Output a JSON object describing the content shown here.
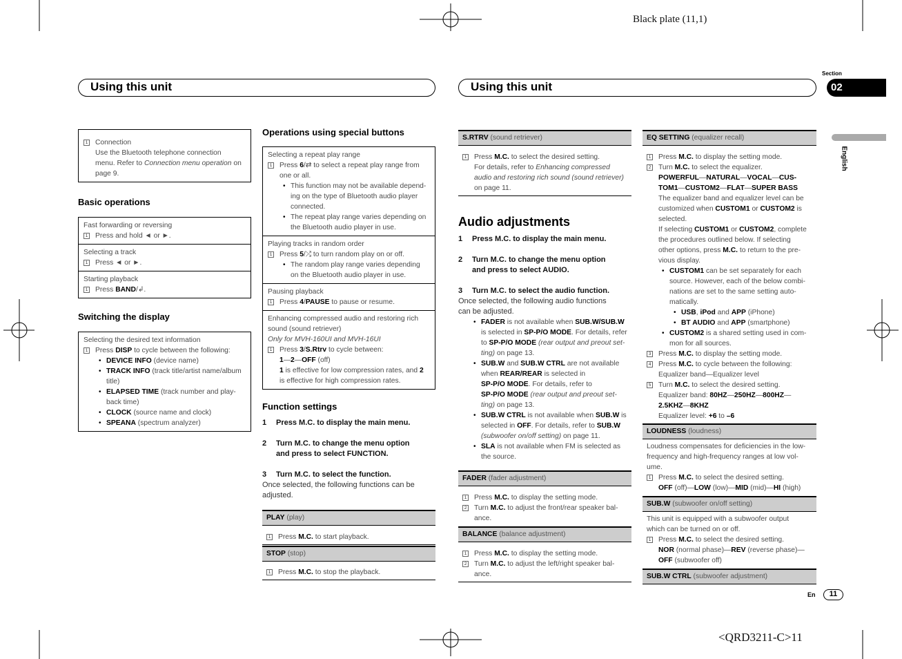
{
  "plate": "Black plate (11,1)",
  "doc_code": "<QRD3211-C>11",
  "left_title": "Using this unit",
  "right_title": "Using this unit",
  "section_label": "Section",
  "section_number": "02",
  "language": "English",
  "footer_lang": "En",
  "page_number": "11",
  "icons": {
    "repeat": "repeat-icon",
    "random": "shuffle-icon",
    "band": "return-icon",
    "prev": "left-triangle",
    "next": "right-triangle"
  },
  "columns": [
    {
      "blocks": [
        {
          "type": "box",
          "rows": [
            [
              [
                "n",
                "Connection",
                "1"
              ],
              [
                "c",
                "Use the Bluetooth telephone connection"
              ],
              [
                "c",
                "menu. Refer to __Connection menu operation__ on"
              ],
              [
                "c",
                "page 9."
              ]
            ]
          ]
        },
        {
          "type": "heading",
          "text": "Basic operations"
        },
        {
          "type": "box",
          "rows": [
            [
              [
                "p",
                "Fast forwarding or reversing"
              ],
              [
                "n",
                "Press and hold ◄ or ►.",
                "1"
              ]
            ],
            [
              [
                "p",
                "Selecting a track"
              ],
              [
                "n",
                "Press ◄ or ►.",
                "1"
              ]
            ],
            [
              [
                "p",
                "Starting playback"
              ],
              [
                "n",
                "Press **BAND**/↲.",
                "1"
              ]
            ]
          ]
        },
        {
          "type": "heading",
          "text": "Switching the display"
        },
        {
          "type": "box",
          "rows": [
            [
              [
                "p",
                "Selecting the desired text information"
              ],
              [
                "n",
                "Press **DISP** to cycle between the following:",
                "1"
              ],
              [
                "b",
                "**DEVICE INFO** (device name)"
              ],
              [
                "b",
                "**TRACK INFO** (track title/artist name/album"
              ],
              [
                "bc",
                "title)"
              ],
              [
                "b",
                "**ELAPSED TIME** (track number and play-"
              ],
              [
                "bc",
                "back time)"
              ],
              [
                "b",
                "**CLOCK** (source name and clock)"
              ],
              [
                "b",
                "**SPEANA** (spectrum analyzer)"
              ]
            ]
          ]
        }
      ]
    },
    {
      "blocks": [
        {
          "type": "heading",
          "text": "Operations using special buttons"
        },
        {
          "type": "box",
          "rows": [
            [
              [
                "p",
                "Selecting a repeat play range"
              ],
              [
                "n",
                "Press **6**/⇄ to select a repeat play range from",
                "1"
              ],
              [
                "c",
                "one or all."
              ],
              [
                "b",
                "This function may not be available depend-"
              ],
              [
                "bc",
                "ing on the type of Bluetooth audio player"
              ],
              [
                "bc",
                "connected."
              ],
              [
                "b",
                "The repeat play range varies depending on"
              ],
              [
                "bc",
                "the Bluetooth audio player in use."
              ]
            ],
            [
              [
                "p",
                "Playing tracks in random order"
              ],
              [
                "n",
                "Press **5**/⤮ to turn random play on or off.",
                "1"
              ],
              [
                "b",
                "The random play range varies depending"
              ],
              [
                "bc",
                "on the Bluetooth audio player in use."
              ]
            ],
            [
              [
                "p",
                "Pausing playback"
              ],
              [
                "n",
                "Press **4**/**PAUSE** to pause or resume.",
                "1"
              ]
            ],
            [
              [
                "p",
                "Enhancing compressed audio and restoring rich"
              ],
              [
                "p",
                "sound (sound retriever)"
              ],
              [
                "p",
                "__Only for MVH-160UI and MVH-16UI__"
              ],
              [
                "n",
                "Press **3**/**S.Rtrv** to cycle between:",
                "1"
              ],
              [
                "c",
                "**1**—**2**—**OFF** (off)"
              ],
              [
                "c",
                "**1** is effective for low compression rates, and **2**"
              ],
              [
                "c",
                "is effective for high compression rates."
              ]
            ]
          ]
        },
        {
          "type": "heading",
          "text": "Function settings"
        },
        {
          "type": "lines",
          "lines": [
            [
              "s",
              "Press M.C. to display the main menu.",
              "1"
            ],
            [
              "gap",
              ""
            ],
            [
              "s",
              "Turn M.C. to change the menu option",
              "2"
            ],
            [
              "s0",
              "and press to select FUNCTION."
            ],
            [
              "gap",
              ""
            ],
            [
              "s",
              "Turn M.C. to select the function.",
              "3"
            ],
            [
              "q",
              "Once selected, the following functions can be"
            ],
            [
              "q",
              "adjusted."
            ]
          ]
        },
        {
          "type": "bar",
          "label": "PLAY",
          "sub": "(play)"
        },
        {
          "type": "lines",
          "lines": [
            [
              "n",
              "Press **M.C.** to start playback.",
              "1"
            ]
          ]
        },
        {
          "type": "bar",
          "label": "STOP",
          "sub": "(stop)"
        },
        {
          "type": "lines",
          "lines": [
            [
              "n",
              "Press **M.C.** to stop the playback.",
              "1"
            ]
          ]
        }
      ]
    },
    {
      "blocks": [
        {
          "type": "bar",
          "label": "S.RTRV",
          "sub": "(sound retriever)"
        },
        {
          "type": "lines",
          "lines": [
            [
              "n",
              "Press **M.C.** to select the desired setting.",
              "1"
            ],
            [
              "c",
              "For details, refer to __Enhancing compressed__"
            ],
            [
              "c",
              "__audio and restoring rich sound (sound retriever)__"
            ],
            [
              "c",
              "on page 11."
            ]
          ]
        },
        {
          "type": "heading",
          "text": "Audio adjustments"
        },
        {
          "type": "lines",
          "lines": [
            [
              "s",
              "Press M.C. to display the main menu.",
              "1"
            ],
            [
              "gap",
              ""
            ],
            [
              "s",
              "Turn M.C. to change the menu option",
              "2"
            ],
            [
              "s0",
              "and press to select AUDIO."
            ],
            [
              "gap",
              ""
            ],
            [
              "s",
              "Turn M.C. to select the audio function.",
              "3"
            ],
            [
              "q",
              "Once selected, the following audio functions"
            ],
            [
              "q",
              "can be adjusted."
            ],
            [
              "b",
              "**FADER** is not available when **SUB.W/SUB.W**"
            ],
            [
              "bc",
              "is selected in **SP-P/O MODE**. For details, refer"
            ],
            [
              "bc",
              "to **SP-P/O MODE** __(rear output and preout set-__"
            ],
            [
              "bc",
              "__ting)__ on page 13."
            ],
            [
              "b",
              "**SUB.W** and **SUB.W CTRL** are not available"
            ],
            [
              "bc",
              "when **REAR/REAR** is selected in"
            ],
            [
              "bc",
              "**SP-P/O MODE**. For details, refer to"
            ],
            [
              "bc",
              "**SP-P/O MODE** __(rear output and preout set-__"
            ],
            [
              "bc",
              "__ting)__ on page 13."
            ],
            [
              "b",
              "**SUB.W CTRL** is not available when **SUB.W** is"
            ],
            [
              "bc",
              "selected in **OFF**. For details, refer to **SUB.W**"
            ],
            [
              "bc",
              "__(subwoofer on/off setting)__ on page 11."
            ],
            [
              "b",
              "**SLA** is not available when FM is selected as"
            ],
            [
              "bc",
              "the source."
            ]
          ]
        },
        {
          "type": "bar",
          "label": "FADER",
          "sub": "(fader adjustment)"
        },
        {
          "type": "lines",
          "lines": [
            [
              "n",
              "Press **M.C.** to display the setting mode.",
              "1"
            ],
            [
              "n",
              "Turn **M.C.** to adjust the front/rear speaker bal-",
              "2"
            ],
            [
              "c",
              "ance."
            ]
          ]
        },
        {
          "type": "bar",
          "label": "BALANCE",
          "sub": "(balance adjustment)"
        },
        {
          "type": "lines",
          "lines": [
            [
              "n",
              "Press **M.C.** to display the setting mode.",
              "1"
            ],
            [
              "n",
              "Turn **M.C.** to adjust the left/right speaker bal-",
              "2"
            ],
            [
              "c",
              "ance."
            ]
          ]
        }
      ]
    },
    {
      "blocks": [
        {
          "type": "bar",
          "label": "EQ SETTING",
          "sub": "(equalizer recall)"
        },
        {
          "type": "lines",
          "lines": [
            [
              "n",
              "Press **M.C.** to display the setting mode.",
              "1"
            ],
            [
              "n",
              "Turn **M.C.** to select the equalizer.",
              "2"
            ],
            [
              "c",
              "**POWERFUL**—**NATURAL**—**VOCAL**—**CUS-**"
            ],
            [
              "c",
              "**TOM1**—**CUSTOM2**—**FLAT**—**SUPER BASS**"
            ],
            [
              "c",
              "The equalizer band and equalizer level can be"
            ],
            [
              "c",
              "customized when **CUSTOM1** or **CUSTOM2** is"
            ],
            [
              "c",
              "selected."
            ],
            [
              "c",
              "If selecting **CUSTOM1** or **CUSTOM2**, complete"
            ],
            [
              "c",
              "the procedures outlined below. If selecting"
            ],
            [
              "c",
              "other options, press **M.C.** to return to the pre-"
            ],
            [
              "c",
              "vious display."
            ],
            [
              "b",
              "**CUSTOM1** can be set separately for each"
            ],
            [
              "bc",
              "source. However, each of the below combi-"
            ],
            [
              "bc",
              "nations are set to the same setting auto-"
            ],
            [
              "bc",
              "matically."
            ],
            [
              "sb",
              "**USB**, **iPod** and **APP** (iPhone)"
            ],
            [
              "sb",
              "**BT AUDIO** and **APP** (smartphone)"
            ],
            [
              "b",
              "**CUSTOM2** is a shared setting used in com-"
            ],
            [
              "bc",
              "mon for all sources."
            ],
            [
              "n",
              "Press **M.C.** to display the setting mode.",
              "3"
            ],
            [
              "n",
              "Press **M.C.** to cycle between the following:",
              "4"
            ],
            [
              "c",
              "Equalizer band—Equalizer level"
            ],
            [
              "n",
              "Turn **M.C.** to select the desired setting.",
              "5"
            ],
            [
              "c",
              "Equalizer band: **80HZ**—**250HZ**—**800HZ**—"
            ],
            [
              "c",
              "**2.5KHZ**—**8KHZ**"
            ],
            [
              "c",
              "Equalizer level: **+6** to **–6**"
            ]
          ]
        },
        {
          "type": "bar",
          "label": "LOUDNESS",
          "sub": "(loudness)"
        },
        {
          "type": "lines",
          "lines": [
            [
              "p",
              "Loudness compensates for deficiencies in the low-"
            ],
            [
              "p",
              "frequency and high-frequency ranges at low vol-"
            ],
            [
              "p",
              "ume."
            ],
            [
              "n",
              "Press **M.C.** to select the desired setting.",
              "1"
            ],
            [
              "c",
              "**OFF** (off)—**LOW** (low)—**MID** (mid)—**HI** (high)"
            ]
          ]
        },
        {
          "type": "bar",
          "label": "SUB.W",
          "sub": "(subwoofer on/off setting)"
        },
        {
          "type": "lines",
          "lines": [
            [
              "p",
              "This unit is equipped with a subwoofer output"
            ],
            [
              "p",
              "which can be turned on or off."
            ],
            [
              "n",
              "Press **M.C.** to select the desired setting.",
              "1"
            ],
            [
              "c",
              "**NOR** (normal phase)—**REV** (reverse phase)—"
            ],
            [
              "c",
              "**OFF** (subwoofer off)"
            ]
          ]
        },
        {
          "type": "bar",
          "label": "SUB.W CTRL",
          "sub": "(subwoofer adjustment)"
        }
      ]
    }
  ]
}
